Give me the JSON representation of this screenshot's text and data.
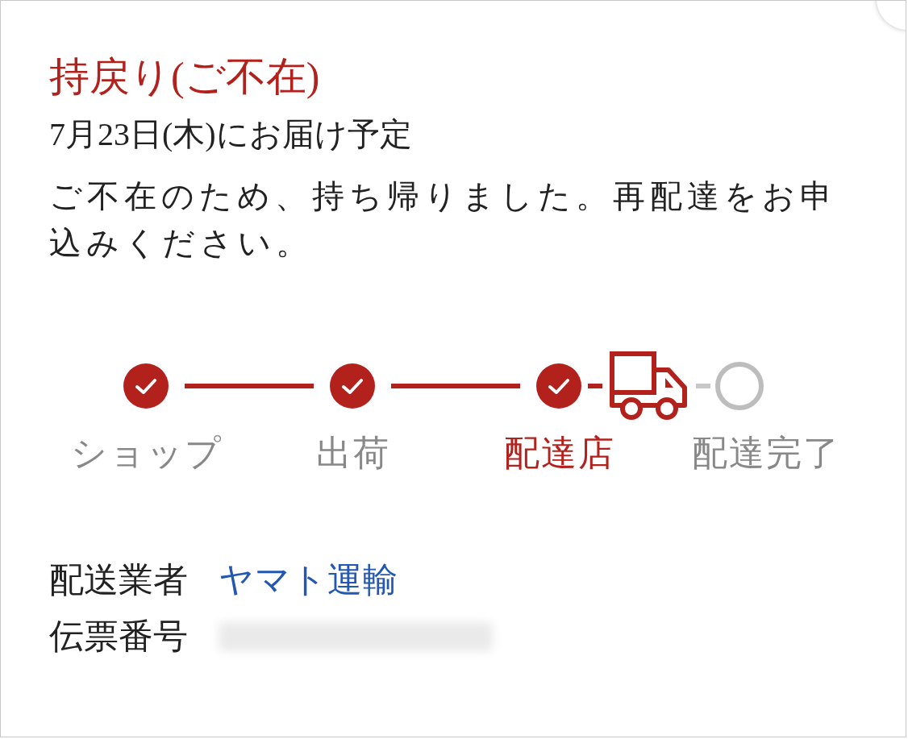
{
  "status": {
    "title": "持戻り(ご不在)",
    "delivery_date": "7月23日(木)にお届け予定",
    "message": "ご不在のため、持ち帰りました。再配達をお申込みください。"
  },
  "progress": {
    "steps": [
      {
        "label": "ショップ",
        "done": true,
        "selected": false
      },
      {
        "label": "出荷",
        "done": true,
        "selected": false
      },
      {
        "label": "配達店",
        "done": true,
        "selected": true
      },
      {
        "label": "配達完了",
        "done": false,
        "selected": false
      }
    ],
    "connectors": [
      {
        "kind": "line"
      },
      {
        "kind": "line"
      },
      {
        "kind": "truck"
      }
    ]
  },
  "details": [
    {
      "label": "配送業者",
      "value": "ヤマト運輸",
      "kind": "link"
    },
    {
      "label": "伝票番号",
      "kind": "redacted"
    }
  ]
}
